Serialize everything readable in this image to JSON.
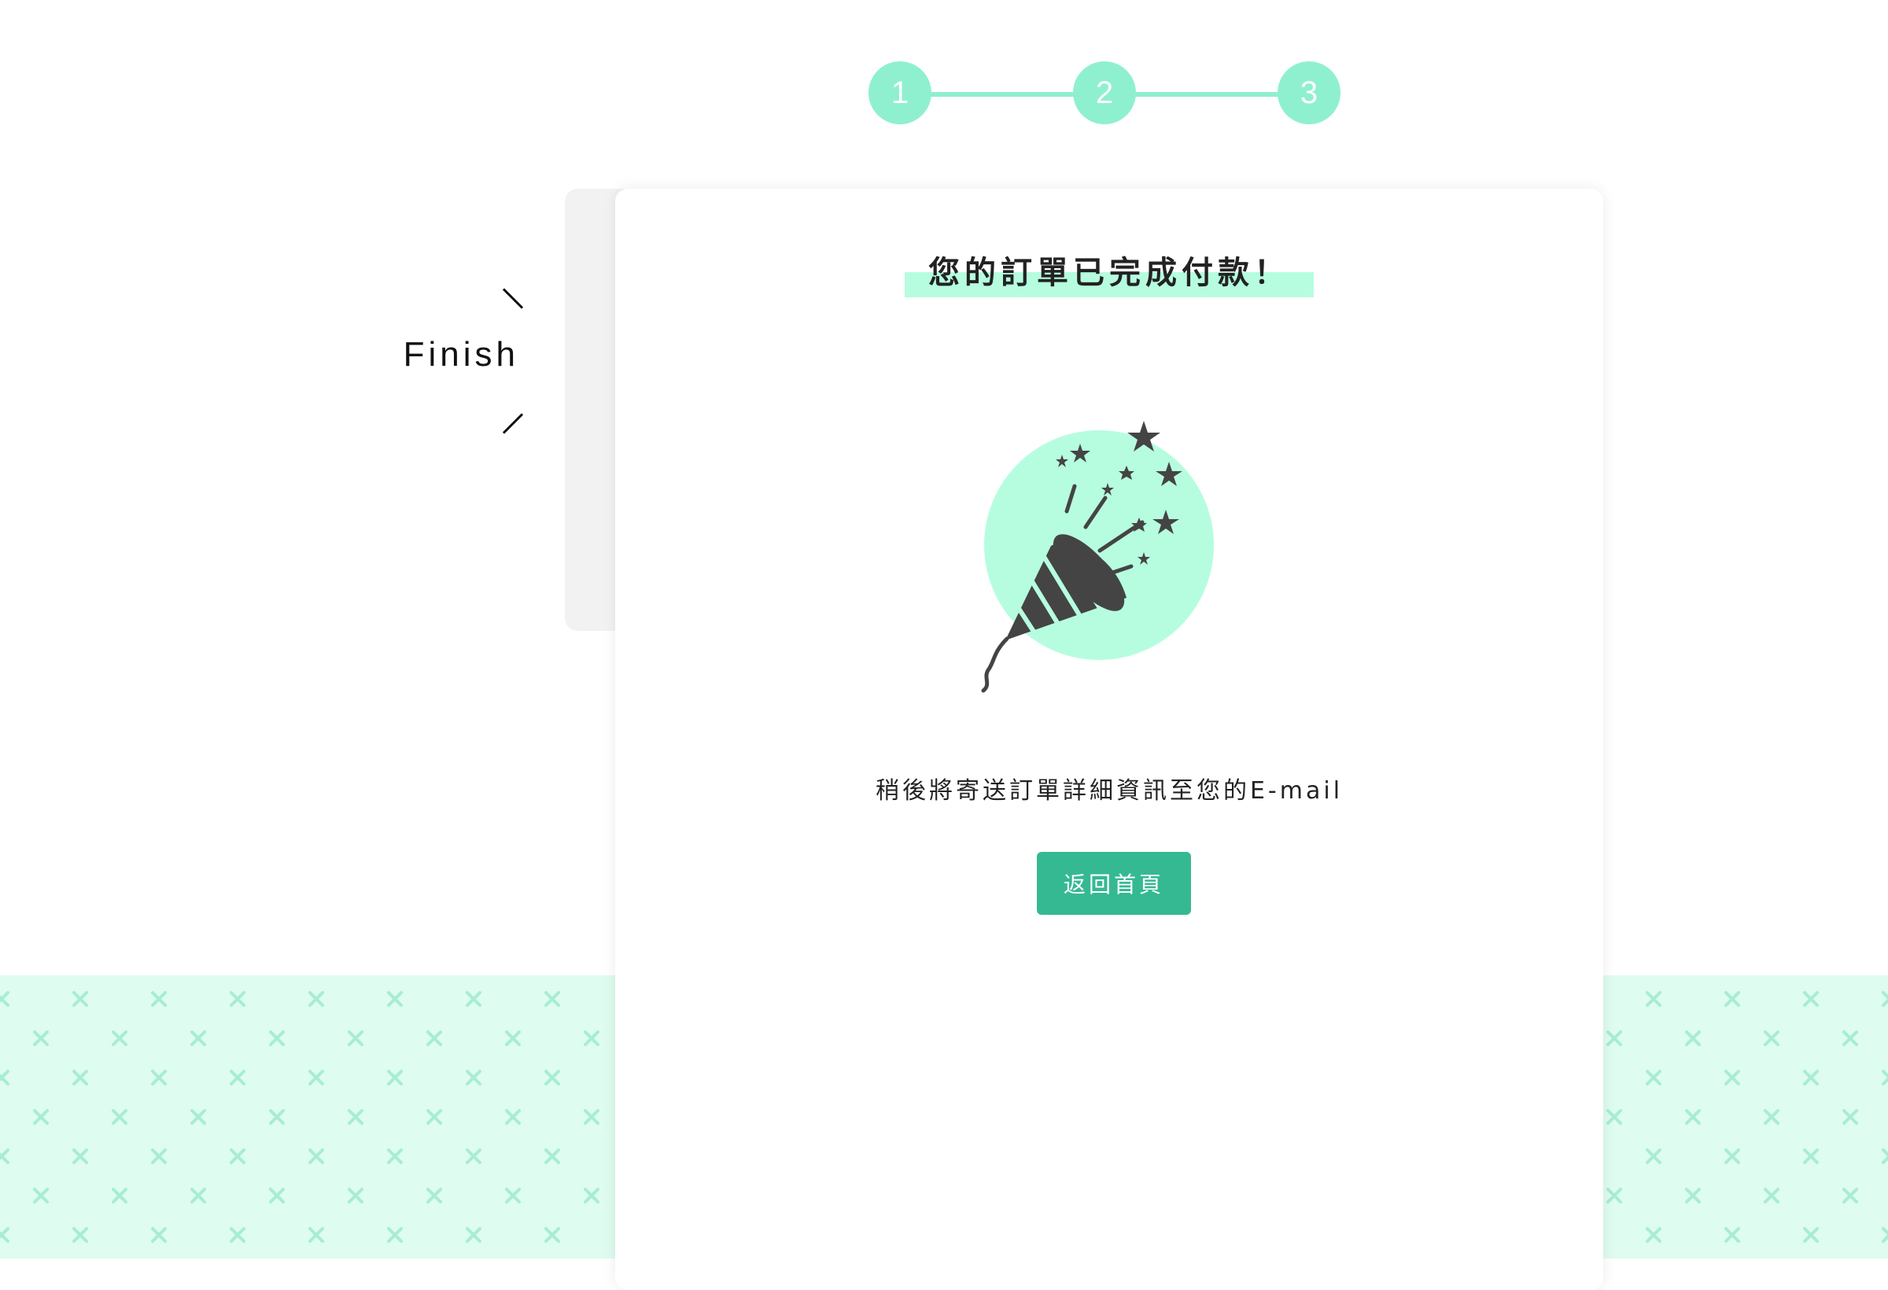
{
  "steps": [
    {
      "number": "1",
      "state": "completed"
    },
    {
      "number": "2",
      "state": "completed"
    },
    {
      "number": "3",
      "state": "current"
    }
  ],
  "side_label": "Finish",
  "card": {
    "title": "您的訂單已完成付款！",
    "message": "稍後將寄送訂單詳細資訊至您的E-mail",
    "home_button_label": "返回首頁",
    "illustration_icon": "party-popper-icon"
  },
  "colors": {
    "accent_light": "#8ff0cf",
    "highlight": "#b6fde0",
    "button": "#35b993",
    "pattern_background": "#defcef",
    "pattern_mark": "#a7edd3",
    "icon_dark": "#444444",
    "side_panel": "#f2f2f2"
  }
}
